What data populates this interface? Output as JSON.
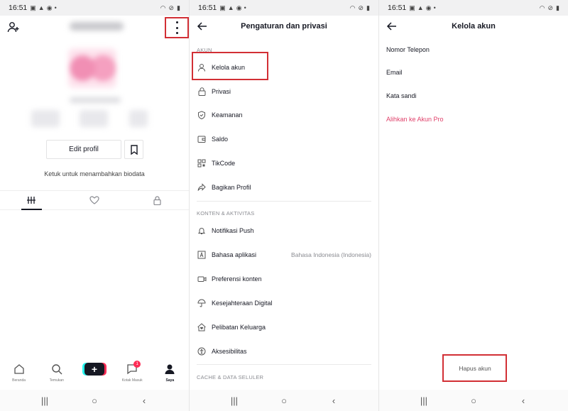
{
  "status": {
    "time": "16:51"
  },
  "colors": {
    "highlight_box": "#d22f35",
    "pink_link": "#e0406a",
    "badge": "#fe2c55"
  },
  "profile": {
    "edit_button": "Edit profil",
    "bio_prompt": "Ketuk untuk menambahkan biodata",
    "nav": {
      "home": "Beranda",
      "discover": "Temukan",
      "create": "+",
      "inbox": "Kotak Masuk",
      "inbox_badge": "1",
      "me": "Saya"
    }
  },
  "settings": {
    "title": "Pengaturan dan privasi",
    "section_account": "AKUN",
    "account_items": [
      {
        "label": "Kelola akun",
        "icon": "person-icon"
      },
      {
        "label": "Privasi",
        "icon": "lock-icon"
      },
      {
        "label": "Keamanan",
        "icon": "shield-icon"
      },
      {
        "label": "Saldo",
        "icon": "wallet-icon"
      },
      {
        "label": "TikCode",
        "icon": "qr-code-icon"
      },
      {
        "label": "Bagikan Profil",
        "icon": "share-icon"
      }
    ],
    "section_content": "KONTEN & AKTIVITAS",
    "content_items": [
      {
        "label": "Notifikasi Push",
        "icon": "bell-icon",
        "value": ""
      },
      {
        "label": "Bahasa aplikasi",
        "icon": "language-icon",
        "value": "Bahasa Indonesia (Indonesia)"
      },
      {
        "label": "Preferensi konten",
        "icon": "video-icon",
        "value": ""
      },
      {
        "label": "Kesejahteraan Digital",
        "icon": "umbrella-icon",
        "value": ""
      },
      {
        "label": "Pelibatan Keluarga",
        "icon": "home-heart-icon",
        "value": ""
      },
      {
        "label": "Aksesibilitas",
        "icon": "accessibility-icon",
        "value": ""
      }
    ],
    "section_cache": "CACHE & DATA SELULER"
  },
  "manage": {
    "title": "Kelola akun",
    "items": [
      "Nomor Telepon",
      "Email",
      "Kata sandi"
    ],
    "pro_link": "Alihkan ke Akun Pro",
    "delete": "Hapus akun"
  }
}
